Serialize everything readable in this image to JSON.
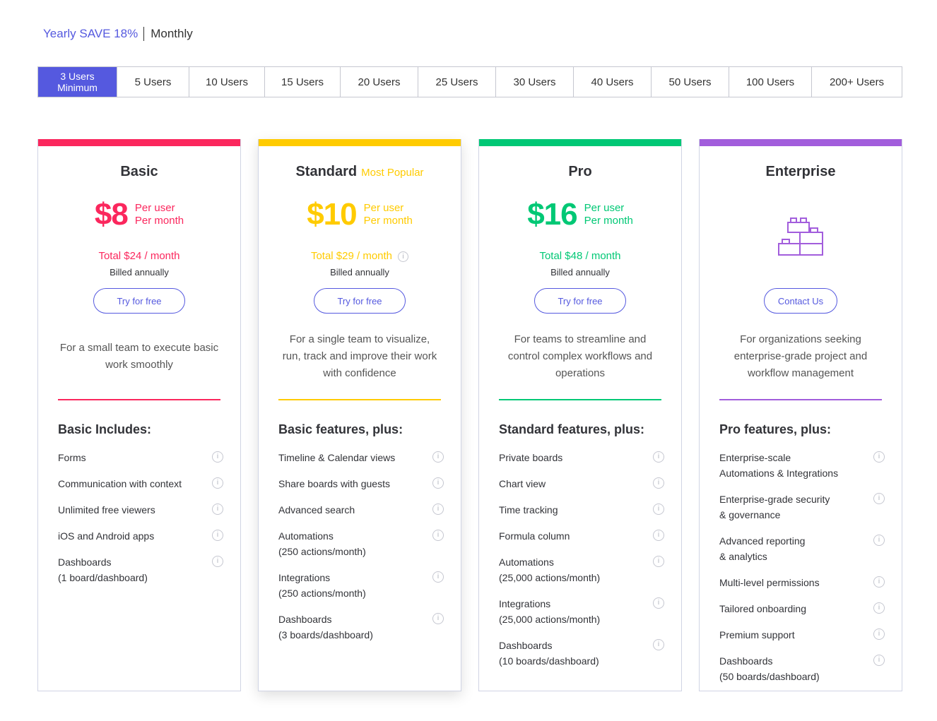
{
  "billing": {
    "yearly": "Yearly SAVE 18%",
    "monthly": "Monthly"
  },
  "user_options": [
    {
      "line1": "3 Users",
      "line2": "Minimum"
    },
    {
      "line1": "5 Users"
    },
    {
      "line1": "10 Users"
    },
    {
      "line1": "15 Users"
    },
    {
      "line1": "20 Users"
    },
    {
      "line1": "25 Users"
    },
    {
      "line1": "30 Users"
    },
    {
      "line1": "40 Users"
    },
    {
      "line1": "50 Users"
    },
    {
      "line1": "100 Users"
    },
    {
      "line1": "200+ Users"
    }
  ],
  "colors": {
    "accent": "#5559df",
    "basic": "#fb275d",
    "standard": "#ffcb00",
    "pro": "#00c875",
    "enterprise": "#a25ddc"
  },
  "plans": {
    "basic": {
      "name": "Basic",
      "price": "$8",
      "per_user": "Per user",
      "per_month": "Per month",
      "total": "Total $24 / month",
      "billed": "Billed annually",
      "cta": "Try for free",
      "desc": "For a small team to execute basic work smoothly",
      "features_title": "Basic Includes:",
      "features": [
        {
          "l1": "Forms"
        },
        {
          "l1": "Communication with context"
        },
        {
          "l1": "Unlimited free viewers"
        },
        {
          "l1": "iOS and Android apps"
        },
        {
          "l1": "Dashboards",
          "l2": "(1 board/dashboard)"
        }
      ]
    },
    "standard": {
      "name": "Standard",
      "tag": "Most Popular",
      "price": "$10",
      "per_user": "Per user",
      "per_month": "Per month",
      "total": "Total $29 / month",
      "billed": "Billed annually",
      "cta": "Try for free",
      "desc": "For a single team to visualize, run, track and improve their work with confidence",
      "features_title": "Basic features, plus:",
      "features": [
        {
          "l1": "Timeline & Calendar views"
        },
        {
          "l1": "Share boards with guests"
        },
        {
          "l1": "Advanced search"
        },
        {
          "l1": "Automations",
          "l2": "(250 actions/month)"
        },
        {
          "l1": "Integrations",
          "l2": "(250 actions/month)"
        },
        {
          "l1": "Dashboards",
          "l2": "(3 boards/dashboard)"
        }
      ]
    },
    "pro": {
      "name": "Pro",
      "price": "$16",
      "per_user": "Per user",
      "per_month": "Per month",
      "total": "Total $48 / month",
      "billed": "Billed annually",
      "cta": "Try for free",
      "desc": "For teams to streamline and control complex workflows and operations",
      "features_title": "Standard features, plus:",
      "features": [
        {
          "l1": "Private boards"
        },
        {
          "l1": "Chart view"
        },
        {
          "l1": "Time tracking"
        },
        {
          "l1": "Formula column"
        },
        {
          "l1": "Automations",
          "l2": "(25,000 actions/month)"
        },
        {
          "l1": "Integrations",
          "l2": "(25,000 actions/month)"
        },
        {
          "l1": "Dashboards",
          "l2": "(10 boards/dashboard)"
        }
      ]
    },
    "enterprise": {
      "name": "Enterprise",
      "cta": "Contact Us",
      "icon": "building-blocks-icon",
      "desc": "For organizations seeking enterprise-grade project and workflow management",
      "features_title": "Pro features, plus:",
      "features": [
        {
          "l1": "Enterprise-scale",
          "l2": "Automations & Integrations"
        },
        {
          "l1": "Enterprise-grade security",
          "l2": "& governance"
        },
        {
          "l1": "Advanced reporting",
          "l2": "& analytics"
        },
        {
          "l1": "Multi-level permissions"
        },
        {
          "l1": "Tailored onboarding"
        },
        {
          "l1": "Premium support"
        },
        {
          "l1": "Dashboards",
          "l2": "(50 boards/dashboard)"
        }
      ]
    }
  }
}
